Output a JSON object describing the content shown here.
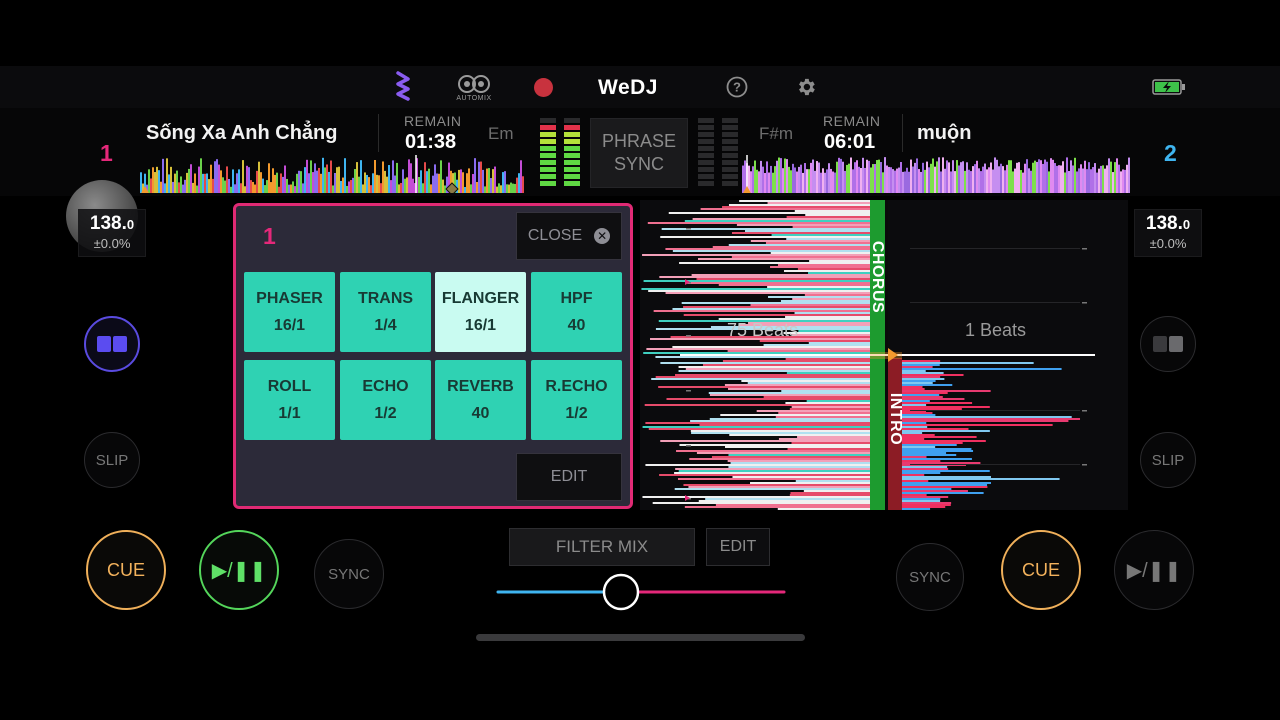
{
  "app": {
    "brand": "WeDJ"
  },
  "topbar": {
    "automix_label": "AUTOMIX",
    "icons": [
      "waveform-icon",
      "automix-icon",
      "record-icon",
      "help-icon",
      "gear-icon",
      "battery-charging-icon"
    ]
  },
  "deck1": {
    "number": "1",
    "title": "Sống Xa Anh Chẳng",
    "remain_label": "REMAIN",
    "remain_time": "01:38",
    "key": "Em",
    "bpm_main": "138.",
    "bpm_decimal": "0",
    "pitch": "±0.0%",
    "slip_label": "SLIP",
    "cue_label": "CUE",
    "play_label": "▶/❚❚",
    "sync_label": "SYNC",
    "color": "#e5287a"
  },
  "deck2": {
    "number": "2",
    "title": "muộn",
    "remain_label": "REMAIN",
    "remain_time": "06:01",
    "key": "F#m",
    "bpm_main": "138.",
    "bpm_decimal": "0",
    "pitch": "±0.0%",
    "slip_label": "SLIP",
    "cue_label": "CUE",
    "play_label": "▶/❚❚",
    "sync_label": "SYNC",
    "color": "#3fb5f0"
  },
  "phrase_sync": {
    "line1": "PHRASE",
    "line2": "SYNC"
  },
  "fx_panel": {
    "deck": "1",
    "close_label": "CLOSE",
    "edit_label": "EDIT",
    "pads": [
      {
        "name": "PHASER",
        "value": "16/1",
        "active": false
      },
      {
        "name": "TRANS",
        "value": "1/4",
        "active": false
      },
      {
        "name": "FLANGER",
        "value": "16/1",
        "active": true
      },
      {
        "name": "HPF",
        "value": "40",
        "active": false
      },
      {
        "name": "ROLL",
        "value": "1/1",
        "active": false
      },
      {
        "name": "ECHO",
        "value": "1/2",
        "active": false
      },
      {
        "name": "REVERB",
        "value": "40",
        "active": false
      },
      {
        "name": "R.ECHO",
        "value": "1/2",
        "active": false
      }
    ]
  },
  "phrase_view": {
    "deck1_beats": "75 Beats",
    "deck2_beats": "1 Beats",
    "deck1_phrase": "CHORUS",
    "deck2_phrase": "INTRO"
  },
  "mixer": {
    "filter_mix_label": "FILTER MIX",
    "edit_label": "EDIT",
    "crossfader_position": 0.43
  }
}
